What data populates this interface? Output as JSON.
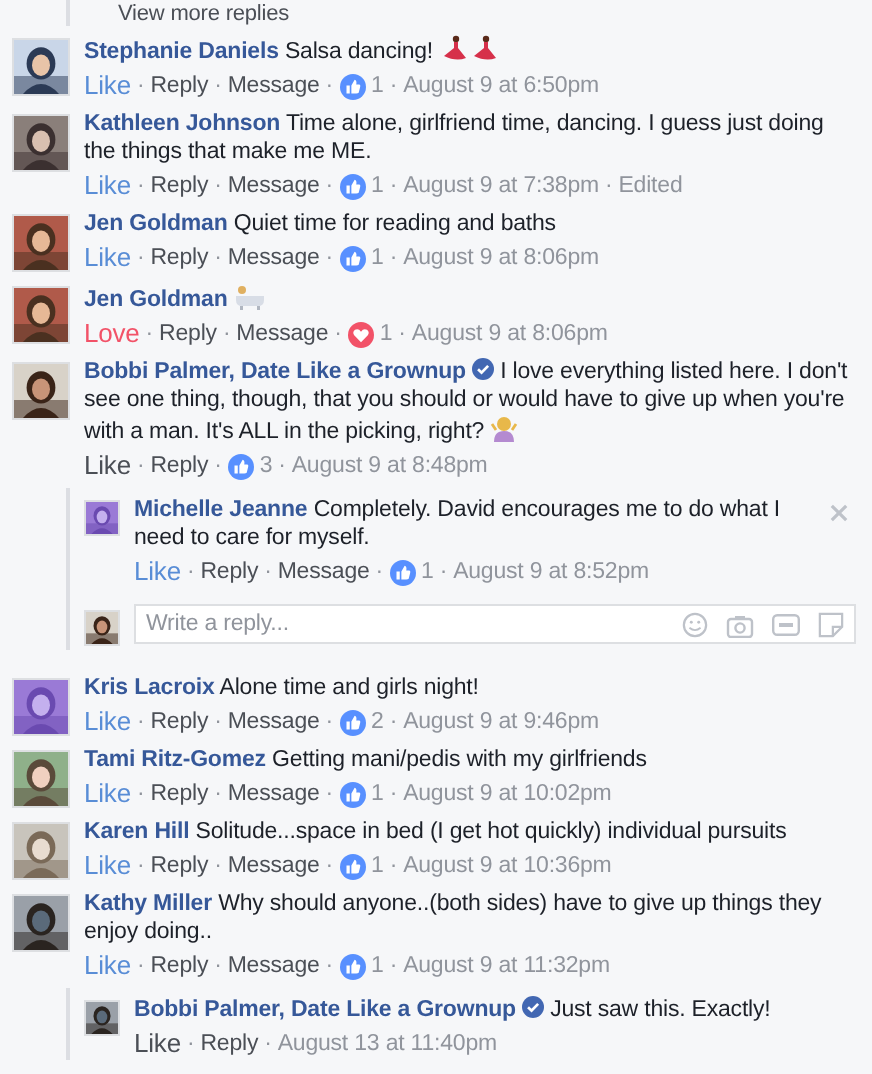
{
  "view_more": "View more replies",
  "separator": "·",
  "comments": [
    {
      "name": "Stephanie Daniels",
      "text": "Salsa dancing!",
      "emoji": [
        {
          "kind": "dancer"
        },
        {
          "kind": "dancer"
        }
      ],
      "actions": [
        {
          "label": "Like",
          "kind": "like",
          "on": true
        },
        {
          "label": "Reply",
          "kind": "plain"
        },
        {
          "label": "Message",
          "kind": "plain"
        }
      ],
      "reaction": {
        "kind": "like",
        "count": "1"
      },
      "time": "August 9 at 6:50pm"
    },
    {
      "name": "Kathleen Johnson",
      "text": "Time alone, girlfriend time, dancing. I guess just doing the things that make me ME.",
      "actions": [
        {
          "label": "Like",
          "kind": "like",
          "on": true
        },
        {
          "label": "Reply",
          "kind": "plain"
        },
        {
          "label": "Message",
          "kind": "plain"
        }
      ],
      "reaction": {
        "kind": "like",
        "count": "1"
      },
      "time": "August 9 at 7:38pm",
      "edited": "Edited"
    },
    {
      "name": "Jen Goldman",
      "text": "Quiet time for reading and baths",
      "actions": [
        {
          "label": "Like",
          "kind": "like",
          "on": true
        },
        {
          "label": "Reply",
          "kind": "plain"
        },
        {
          "label": "Message",
          "kind": "plain"
        }
      ],
      "reaction": {
        "kind": "like",
        "count": "1"
      },
      "time": "August 9 at 8:06pm"
    },
    {
      "name": "Jen Goldman",
      "emoji": [
        {
          "kind": "bathtub"
        }
      ],
      "actions": [
        {
          "label": "Love",
          "kind": "love",
          "on": true
        },
        {
          "label": "Reply",
          "kind": "plain"
        },
        {
          "label": "Message",
          "kind": "plain"
        }
      ],
      "reaction": {
        "kind": "love",
        "count": "1"
      },
      "time": "August 9 at 8:06pm"
    },
    {
      "name": "Bobbi Palmer, Date Like a Grownup",
      "verified": true,
      "text": "I love everything listed here. I don't see one thing, though, that you should or would have to give up when you're with a man. It's ALL in the picking, right?",
      "emoji": [
        {
          "kind": "shrug"
        }
      ],
      "actions": [
        {
          "label": "Like",
          "kind": "like",
          "on": false
        },
        {
          "label": "Reply",
          "kind": "plain"
        }
      ],
      "reaction": {
        "kind": "like",
        "count": "3"
      },
      "time": "August 9 at 8:48pm",
      "replies": [
        {
          "name": "Michelle Jeanne",
          "text": "Completely. David encourages me to do what I need to care for myself.",
          "closable": true,
          "actions": [
            {
              "label": "Like",
              "kind": "like",
              "on": true
            },
            {
              "label": "Reply",
              "kind": "plain"
            },
            {
              "label": "Message",
              "kind": "plain"
            }
          ],
          "reaction": {
            "kind": "like",
            "count": "1"
          },
          "time": "August 9 at 8:52pm"
        }
      ],
      "reply_box": {
        "placeholder": "Write a reply..."
      }
    },
    {
      "name": "Kris Lacroix",
      "text": "Alone time and girls night!",
      "actions": [
        {
          "label": "Like",
          "kind": "like",
          "on": true
        },
        {
          "label": "Reply",
          "kind": "plain"
        },
        {
          "label": "Message",
          "kind": "plain"
        }
      ],
      "reaction": {
        "kind": "like",
        "count": "2"
      },
      "time": "August 9 at 9:46pm"
    },
    {
      "name": "Tami Ritz-Gomez",
      "text": "Getting mani/pedis with my girlfriends",
      "actions": [
        {
          "label": "Like",
          "kind": "like",
          "on": true
        },
        {
          "label": "Reply",
          "kind": "plain"
        },
        {
          "label": "Message",
          "kind": "plain"
        }
      ],
      "reaction": {
        "kind": "like",
        "count": "1"
      },
      "time": "August 9 at 10:02pm"
    },
    {
      "name": "Karen Hill",
      "text": "Solitude...space in bed (I get hot quickly) individual pursuits",
      "actions": [
        {
          "label": "Like",
          "kind": "like",
          "on": true
        },
        {
          "label": "Reply",
          "kind": "plain"
        },
        {
          "label": "Message",
          "kind": "plain"
        }
      ],
      "reaction": {
        "kind": "like",
        "count": "1"
      },
      "time": "August 9 at 10:36pm"
    },
    {
      "name": "Kathy Miller",
      "text": "Why should anyone..(both sides) have to give up things they enjoy doing..",
      "actions": [
        {
          "label": "Like",
          "kind": "like",
          "on": true
        },
        {
          "label": "Reply",
          "kind": "plain"
        },
        {
          "label": "Message",
          "kind": "plain"
        }
      ],
      "reaction": {
        "kind": "like",
        "count": "1"
      },
      "time": "August 9 at 11:32pm",
      "replies": [
        {
          "name": "Bobbi Palmer, Date Like a Grownup",
          "verified": true,
          "text": "Just saw this. Exactly!",
          "actions": [
            {
              "label": "Like",
              "kind": "like",
              "on": false
            },
            {
              "label": "Reply",
              "kind": "plain"
            }
          ],
          "time": "August 13 at 11:40pm"
        }
      ]
    }
  ]
}
